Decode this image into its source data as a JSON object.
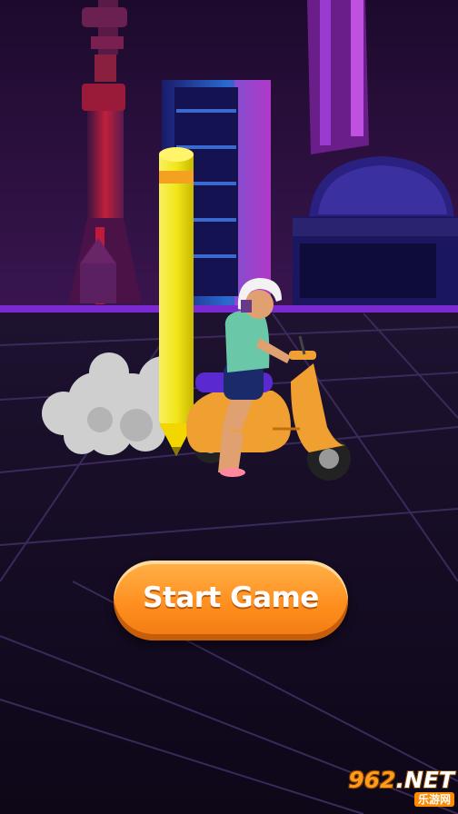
{
  "start_button": {
    "label": "Start Game"
  },
  "watermark": {
    "brand_number": "962",
    "brand_suffix": ".NET",
    "site_name": "乐游网"
  },
  "colors": {
    "sky": "#2a0f3f",
    "floor": "#160c24",
    "neon_purple": "#8a2be2",
    "pencil": "#f4e81a",
    "scooter": "#f0a030",
    "button": "#ff9422"
  }
}
